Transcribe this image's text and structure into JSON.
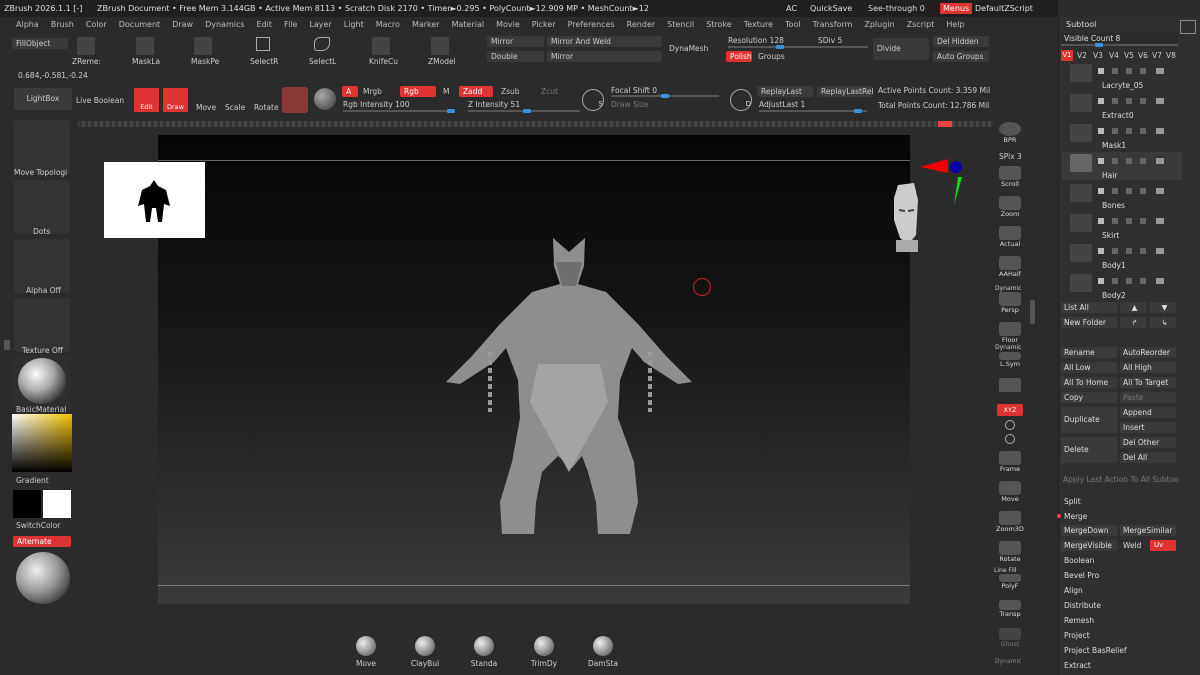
{
  "title_bar": {
    "app": "ZBrush 2026.1.1 [-]",
    "document": "ZBrush Document",
    "stats": "• Free Mem 3.144GB • Active Mem 8113 • Scratch Disk 2170 • Timer►0.295 • PolyCount►12.909 MP • MeshCount►12",
    "ac": "AC",
    "quicksave": "QuickSave",
    "seethrough": "See-through 0",
    "menus": "Menus",
    "script": "DefaultZScript"
  },
  "menus": [
    "Alpha",
    "Brush",
    "Color",
    "Document",
    "Draw",
    "Dynamics",
    "Edit",
    "File",
    "Layer",
    "Light",
    "Macro",
    "Marker",
    "Material",
    "Movie",
    "Picker",
    "Preferences",
    "Render",
    "Stencil",
    "Stroke",
    "Texture",
    "Tool",
    "Transform",
    "Zplugin",
    "Zscript",
    "Help"
  ],
  "toolbar": {
    "fillobject": "FillObject",
    "coords": "0.684,-0.581,-0.24",
    "zremesher": "ZReme:",
    "maskla": "MaskLa",
    "maskpe": "MaskPe",
    "selectr": "SelectR",
    "selectl": "SelectL",
    "knifecu": "KnifeCu",
    "zmodel": "ZModel",
    "mirror": "Mirror",
    "mirror_weld": "Mirror And Weld",
    "double": "Double",
    "mirror2": "Mirror",
    "dynamesh": "DynaMesh",
    "resolution": "Resolution 128",
    "sdiv": "SDiv 5",
    "divide": "Divide",
    "del_hidden": "Del Hidden",
    "polish": "Polish",
    "groups": "Groups",
    "auto_groups": "Auto Groups",
    "lightbox": "LightBox",
    "live_boolean": "Live Boolean",
    "edit": "Edit",
    "draw": "Draw",
    "move": "Move",
    "scale": "Scale",
    "rotate": "Rotate",
    "a": "A",
    "mrgb": "Mrgb",
    "rgb": "Rgb",
    "m": "M",
    "zadd": "Zadd",
    "zsub": "Zsub",
    "zcut": "Zcut",
    "rgb_intensity": "Rgb Intensity 100",
    "z_intensity": "Z Intensity 51",
    "focal_shift": "Focal Shift 0",
    "draw_size": "Draw Size",
    "s": "S",
    "d": "D",
    "replaylast": "ReplayLast",
    "replaylastrel": "ReplayLastRel",
    "adjustlast": "AdjustLast 1",
    "active_points": "Active Points Count: 3.359 Mil",
    "total_points": "Total Points Count: 12.786 Mil"
  },
  "left_shelf": [
    "Move Topologi",
    "Dots",
    "Alpha Off",
    "Texture Off",
    "BasicMaterial",
    "Gradient",
    "SwitchColor",
    "Alternate"
  ],
  "right_shelf": [
    "BPR",
    "SPix 3",
    "Scroll",
    "Zoom",
    "Actual",
    "AAHalf",
    "Dynamic",
    "Persp",
    "Floor",
    "Dynamic",
    "L.Sym",
    "Frame",
    "Move",
    "Zoom3D",
    "Rotate",
    "Line Fill",
    "PolyF",
    "Transp",
    "Ghost",
    "Dynamic"
  ],
  "right_extra": {
    "xyz": "XYZ"
  },
  "bottom_brushes": [
    "Move",
    "ClayBui",
    "Standa",
    "TrimDy",
    "DamSta"
  ],
  "subtool": {
    "title": "Subtool",
    "visible_count": "Visible Count 8",
    "versions": [
      "V1",
      "V2",
      "V3",
      "V4",
      "V5",
      "V6",
      "V7",
      "V8"
    ],
    "items": [
      "Lacryte_05",
      "Extract0",
      "Mask1",
      "Hair",
      "Bones",
      "Skirt",
      "Body1",
      "Body2"
    ],
    "list_all": "List All",
    "new_folder": "New Folder",
    "rename": "Rename",
    "autoreorder": "AutoReorder",
    "all_low": "All Low",
    "all_high": "All High",
    "all_to_home": "All To Home",
    "all_to_target": "All To Target",
    "copy": "Copy",
    "paste": "Paste",
    "duplicate": "Duplicate",
    "append": "Append",
    "insert": "Insert",
    "delete": "Delete",
    "del_other": "Del Other",
    "del_all": "Del All",
    "apply_last": "Apply Last Action To All Subtoo",
    "split": "Split",
    "merge": "Merge",
    "mergedown": "MergeDown",
    "mergesimilar": "MergeSimilar",
    "mergevisible": "MergeVisible",
    "weld": "Weld",
    "uv": "Uv",
    "sections": [
      "Boolean",
      "Bevel Pro",
      "Align",
      "Distribute",
      "Remesh",
      "Project",
      "Project BasRelief",
      "Extract"
    ]
  }
}
